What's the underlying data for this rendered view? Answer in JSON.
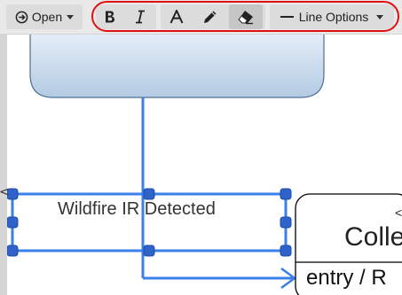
{
  "toolbar": {
    "open_label": "Open",
    "line_options_label": "Line Options",
    "icons": {
      "open": "circle-arrow-right-icon",
      "bold": "bold-icon",
      "italic": "italic-icon",
      "text_color": "font-color-icon",
      "pen": "pencil-icon",
      "eraser": "eraser-icon",
      "line": "line-style-icon",
      "dropdown": "caret-down-icon"
    },
    "highlight_color": "#e01010"
  },
  "canvas": {
    "node_label": "Wildfire IR Detected",
    "partial_node_title": "Colle",
    "partial_node_row": "entry / R",
    "partial_node_marker": "<",
    "colors": {
      "connector": "#3b7fe8",
      "top_box_fill_top": "#e4edf7",
      "top_box_fill_bottom": "#b3cbe3",
      "handle_fill": "#2f63c9"
    }
  },
  "sidebar": {
    "collapse_icon": "chevron-left-icon",
    "collapse_glyph": "<"
  }
}
